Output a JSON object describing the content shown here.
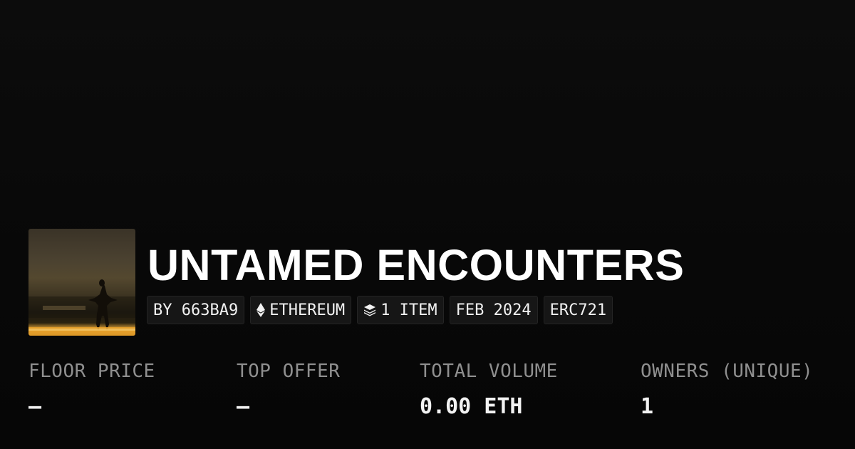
{
  "collection": {
    "name": "UNTAMED ENCOUNTERS"
  },
  "tags": {
    "creator": "BY 663BA9",
    "chain": "ETHEREUM",
    "items": "1 ITEM",
    "date": "FEB 2024",
    "standard": "ERC721"
  },
  "icons": {
    "chain": "ethereum-icon",
    "items": "layers-icon"
  },
  "stats": {
    "floor_price": {
      "label": "FLOOR PRICE",
      "value": "—"
    },
    "top_offer": {
      "label": "TOP OFFER",
      "value": "—"
    },
    "total_volume": {
      "label": "TOTAL VOLUME",
      "value": "0.00 ETH"
    },
    "owners": {
      "label": "OWNERS (UNIQUE)",
      "value": "1"
    }
  },
  "colors": {
    "background": "#0a0a0a",
    "tag_background": "#161616",
    "label": "#8f8f8f",
    "value": "#f2f2f2"
  }
}
